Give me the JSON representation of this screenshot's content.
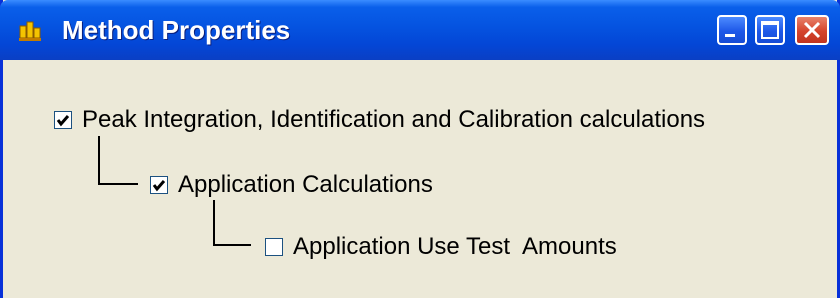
{
  "window": {
    "title": "Method Properties",
    "icon": "method-properties-icon"
  },
  "titlebar_buttons": {
    "minimize_icon": "minimize-icon",
    "maximize_icon": "maximize-icon",
    "close_icon": "close-icon"
  },
  "options": [
    {
      "label": "Peak Integration, Identification and Calibration calculations",
      "checked": true
    },
    {
      "label": "Application Calculations",
      "checked": true
    },
    {
      "label": "Application Use Test  Amounts",
      "checked": false
    }
  ],
  "colors": {
    "titlebar": "#0553E0",
    "window_bg": "#ECE9D8",
    "close_button": "#D5442C"
  }
}
